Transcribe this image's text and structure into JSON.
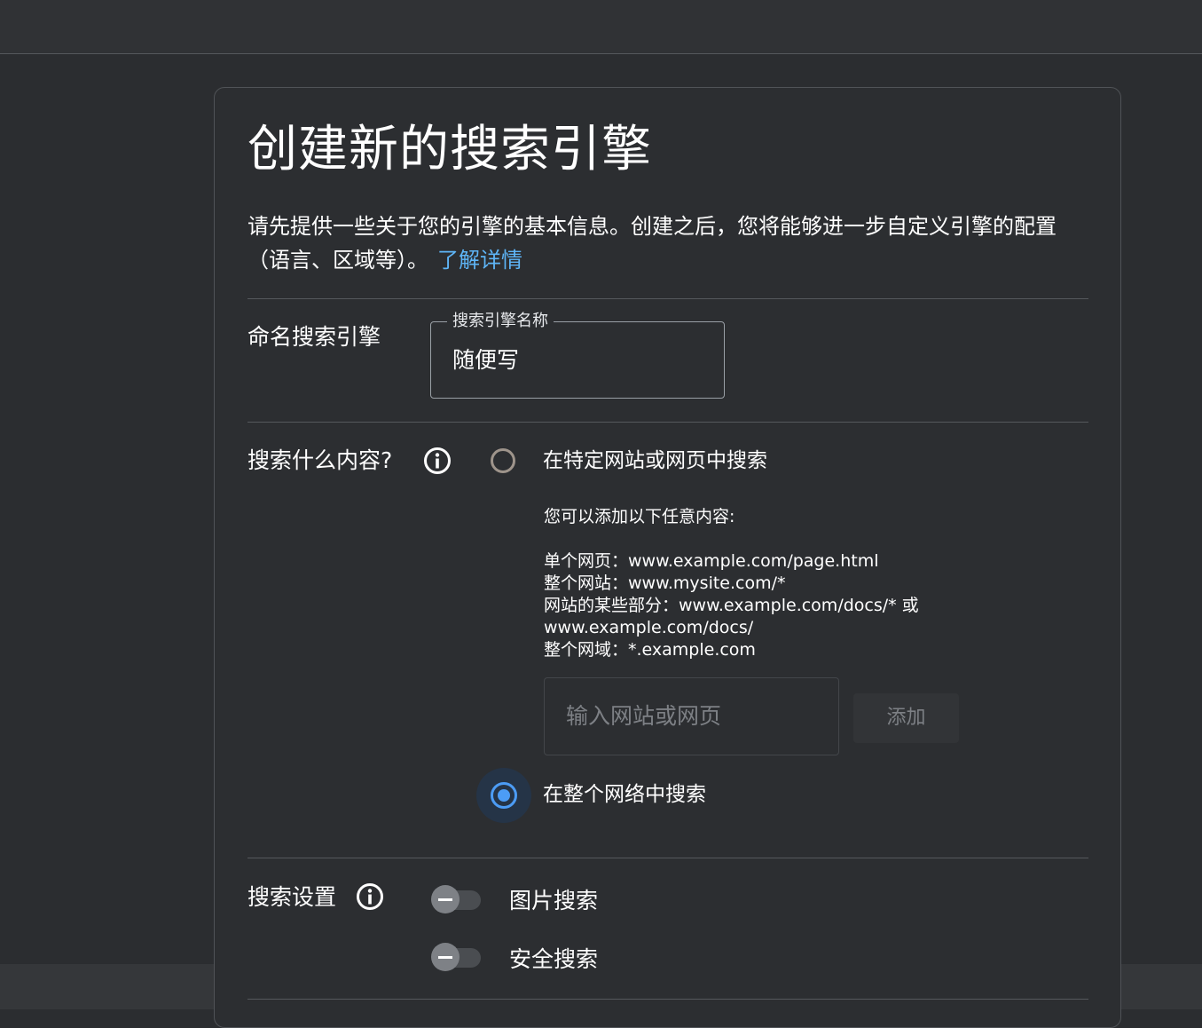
{
  "page": {
    "title": "创建新的搜索引擎",
    "intro": "请先提供一些关于您的引擎的基本信息。创建之后，您将能够进一步自定义引擎的配置（语言、区域等）。",
    "learn_more": "了解详情"
  },
  "name_section": {
    "label": "命名搜索引擎",
    "field_label": "搜索引擎名称",
    "field_value": "随便写"
  },
  "content_section": {
    "label": "搜索什么内容?",
    "option_specific": "在特定网站或网页中搜索",
    "help_title": "您可以添加以下任意内容:",
    "help_lines": [
      "单个网页：www.example.com/page.html",
      "整个网站：www.mysite.com/*",
      "网站的某些部分：www.example.com/docs/* 或",
      "www.example.com/docs/",
      "整个网域：*.example.com"
    ],
    "site_placeholder": "输入网站或网页",
    "add_button": "添加",
    "option_entire_web": "在整个网络中搜索",
    "selected_option": "option_entire_web"
  },
  "settings_section": {
    "label": "搜索设置",
    "image_search": "图片搜索",
    "image_search_enabled": false,
    "safe_search": "安全搜索",
    "safe_search_enabled": false
  },
  "colors": {
    "accent": "#4c9cf5",
    "link": "#5eb5f7",
    "background": "#2b2d30"
  },
  "icons": {
    "info": "info-icon",
    "radio_unselected": "radio-unselected-icon",
    "radio_selected": "radio-selected-icon"
  }
}
